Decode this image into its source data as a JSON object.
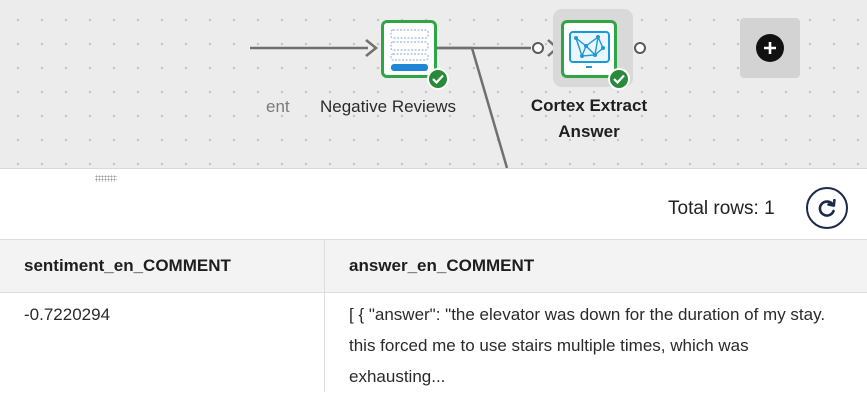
{
  "canvas": {
    "nodes": [
      {
        "id": "sentiment",
        "label_partial": "ent"
      },
      {
        "id": "negative-reviews",
        "label": "Negative Reviews"
      },
      {
        "id": "cortex-extract",
        "label_line1": "Cortex Extract",
        "label_line2": "Answer",
        "selected": true
      }
    ],
    "status_icon": "check-icon",
    "add_icon": "plus-icon"
  },
  "results": {
    "total_rows_label": "Total rows: 1",
    "refresh_icon": "refresh-icon",
    "columns": [
      "sentiment_en_COMMENT",
      "answer_en_COMMENT"
    ],
    "rows": [
      {
        "sentiment": "-0.7220294",
        "answer": "[ { \"answer\": \"the elevator was down for the duration of my stay. this forced me to use stairs multiple times, which was exhausting..."
      }
    ]
  },
  "colors": {
    "node_border": "#2fa546",
    "badge": "#2a8a3c",
    "refresh_ring": "#1b2a4a"
  }
}
